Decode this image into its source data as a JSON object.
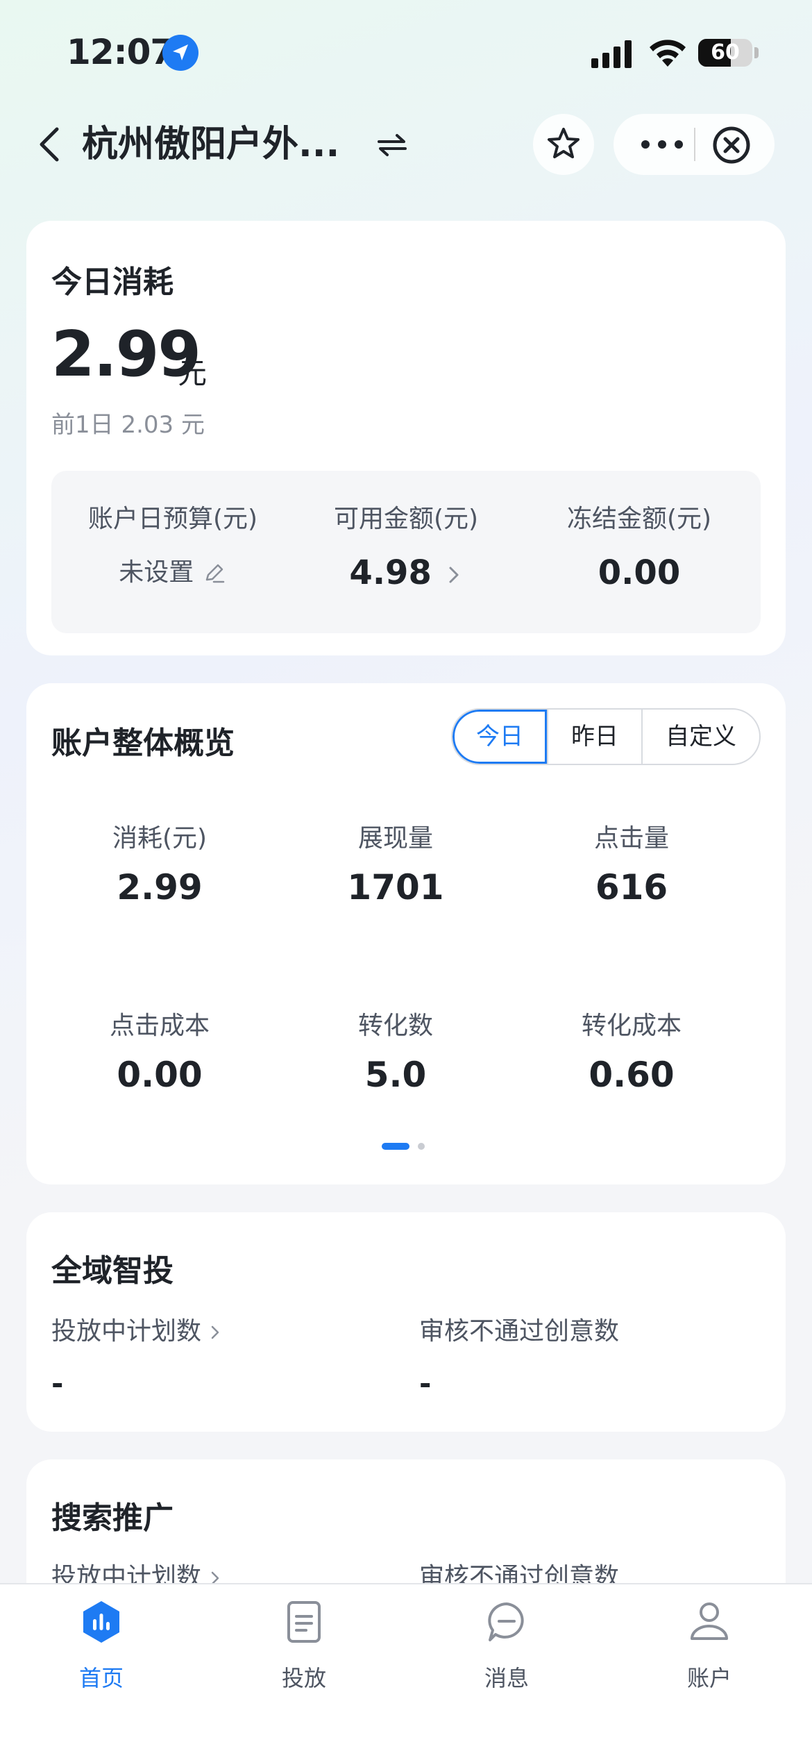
{
  "status_bar": {
    "time": "12:07",
    "battery": "60",
    "battery_level": 0.6
  },
  "nav": {
    "title": "杭州傲阳户外..."
  },
  "today_card": {
    "title": "今日消耗",
    "value": "2.99",
    "unit": "元",
    "prev_day": "前1日 2.03 元",
    "budget_label": "账户日预算(元)",
    "budget_value": "未设置",
    "available_label": "可用金额(元)",
    "available_value": "4.98",
    "frozen_label": "冻结金额(元)",
    "frozen_value": "0.00"
  },
  "overview_card": {
    "title": "账户整体概览",
    "tabs": [
      {
        "label": "今日",
        "active": true
      },
      {
        "label": "昨日",
        "active": false
      },
      {
        "label": "自定义",
        "active": false
      }
    ],
    "metrics": [
      {
        "label": "消耗(元)",
        "value": "2.99"
      },
      {
        "label": "展现量",
        "value": "1701"
      },
      {
        "label": "点击量",
        "value": "616"
      },
      {
        "label": "点击成本",
        "value": "0.00"
      },
      {
        "label": "转化数",
        "value": "5.0"
      },
      {
        "label": "转化成本",
        "value": "0.60"
      }
    ],
    "page_index": 1,
    "page_count": 2
  },
  "smart_card": {
    "title": "全域智投",
    "active_plans_label": "投放中计划数",
    "active_plans_value": "-",
    "rejected_label": "审核不通过创意数",
    "rejected_value": "-"
  },
  "search_card": {
    "title": "搜索推广",
    "active_plans_label": "投放中计划数",
    "rejected_label": "审核不通过创意数"
  },
  "tab_bar": {
    "items": [
      {
        "label": "首页",
        "icon": "home-chart-icon",
        "active": true
      },
      {
        "label": "投放",
        "icon": "document-icon",
        "active": false
      },
      {
        "label": "消息",
        "icon": "message-icon",
        "active": false
      },
      {
        "label": "账户",
        "icon": "user-icon",
        "active": false
      }
    ]
  },
  "colors": {
    "accent": "#1e7bf3",
    "text": "#1f2329",
    "muted": "#8a8f99"
  }
}
